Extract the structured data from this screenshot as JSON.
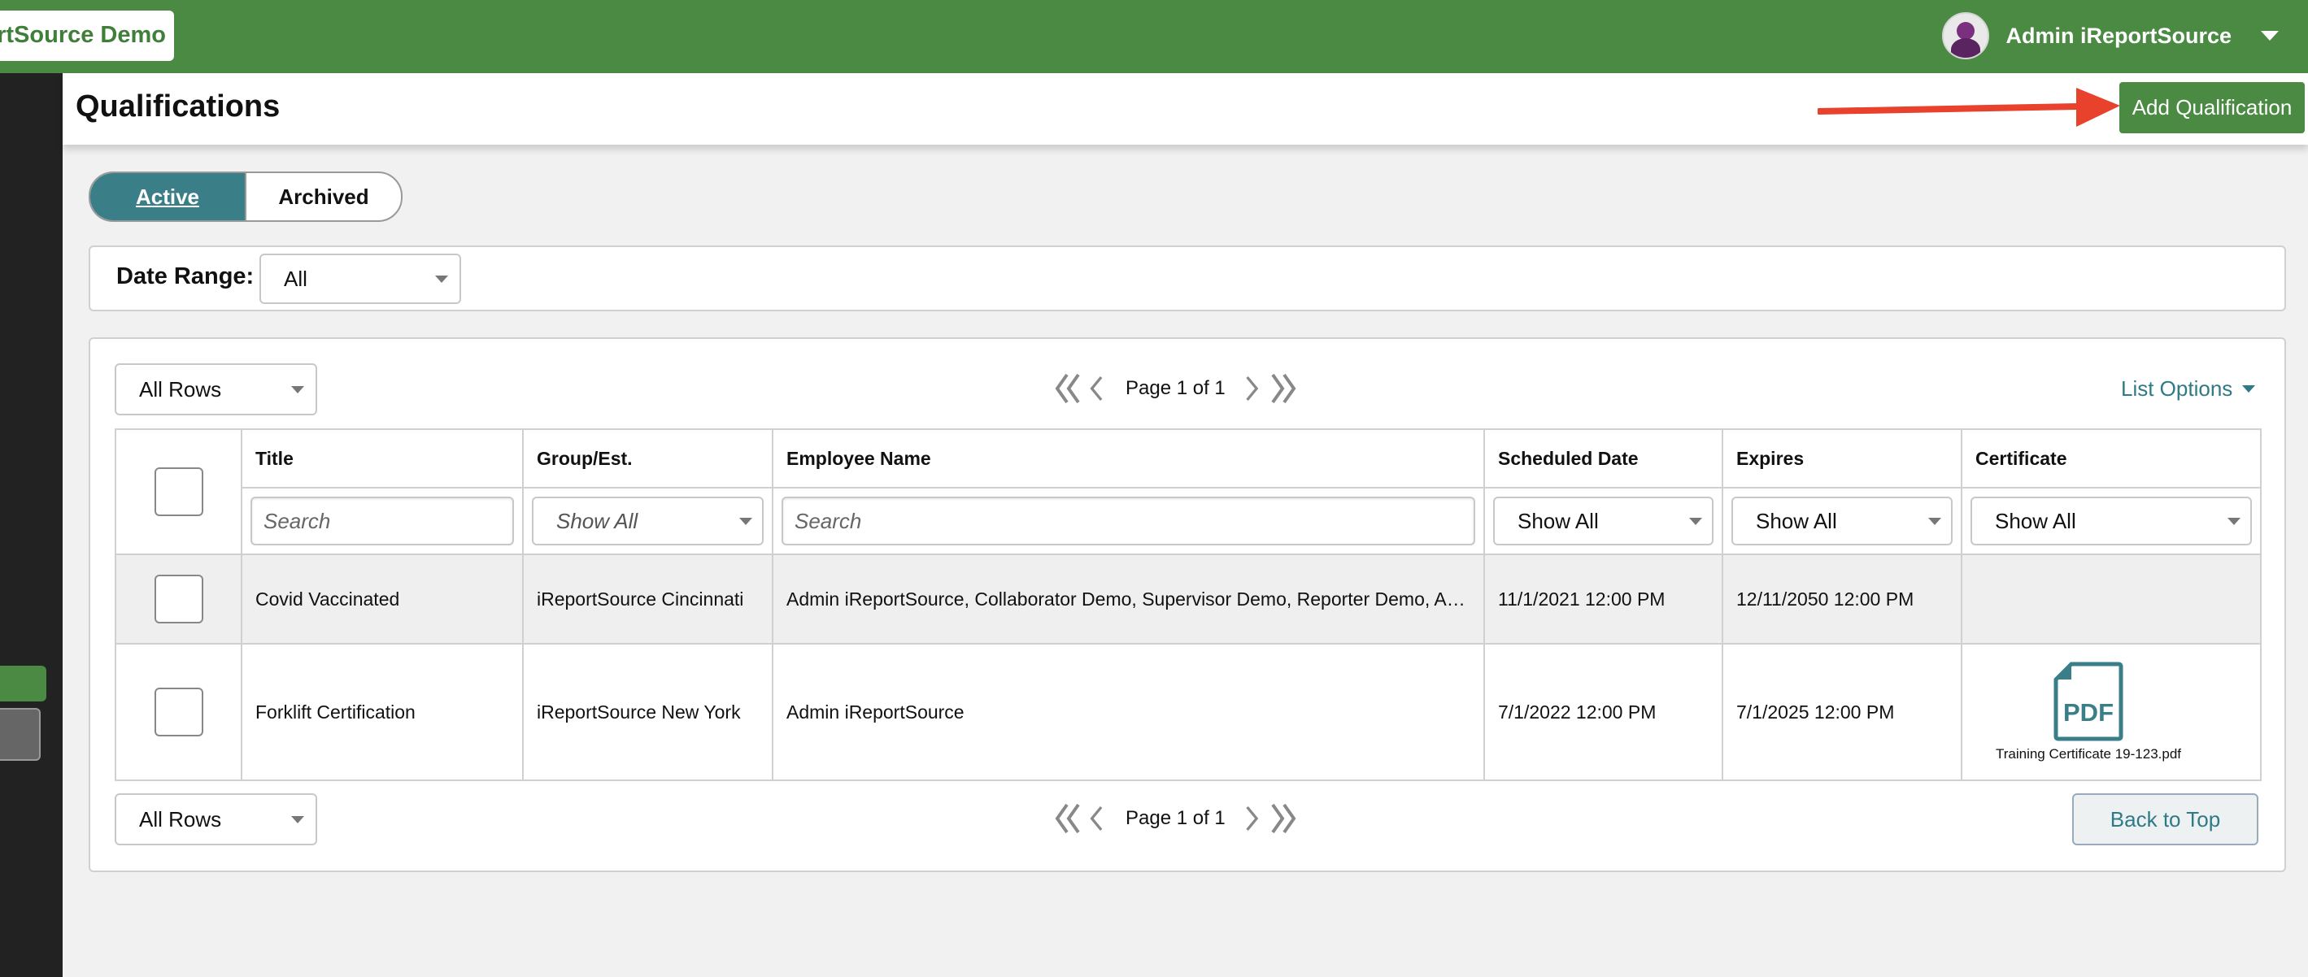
{
  "app": {
    "brand": "rtSource Demo"
  },
  "user": {
    "name": "Admin iReportSource"
  },
  "page": {
    "title": "Qualifications",
    "add_button": "Add Qualification"
  },
  "tabs": [
    {
      "label": "Active"
    },
    {
      "label": "Archived"
    }
  ],
  "filters": {
    "date_range_label": "Date Range:",
    "date_range_value": "All"
  },
  "list": {
    "rows_select": "All Rows",
    "page_text": "Page 1 of 1",
    "list_options": "List Options",
    "back_to_top": "Back to Top"
  },
  "table": {
    "columns": [
      "Title",
      "Group/Est.",
      "Employee Name",
      "Scheduled Date",
      "Expires",
      "Certificate"
    ],
    "filter_row": {
      "title_placeholder": "Search",
      "group_select": "Show All",
      "employee_placeholder": "Search",
      "scheduled_select": "Show All",
      "expires_select": "Show All",
      "certificate_select": "Show All"
    },
    "rows": [
      {
        "title": "Covid Vaccinated",
        "group": "iReportSource Cincinnati",
        "employee": "Admin iReportSource, Collaborator Demo, Supervisor Demo, Reporter Demo, Ada...",
        "scheduled": "11/1/2021 12:00 PM",
        "expires": "12/11/2050 12:00 PM",
        "certificate": ""
      },
      {
        "title": "Forklift Certification",
        "group": "iReportSource New York",
        "employee": "Admin iReportSource",
        "scheduled": "7/1/2022 12:00 PM",
        "expires": "7/1/2025 12:00 PM",
        "certificate": "Training Certificate 19-123.pdf",
        "certificate_icon_text": "PDF"
      }
    ]
  },
  "colors": {
    "brand_green": "#4a8a42",
    "teal": "#3a7f88",
    "arrow_red": "#e8412c"
  },
  "icons": [
    "caret-down-icon",
    "first-page-icon",
    "prev-page-icon",
    "next-page-icon",
    "last-page-icon",
    "pdf-file-icon",
    "red-arrow-annotation"
  ]
}
